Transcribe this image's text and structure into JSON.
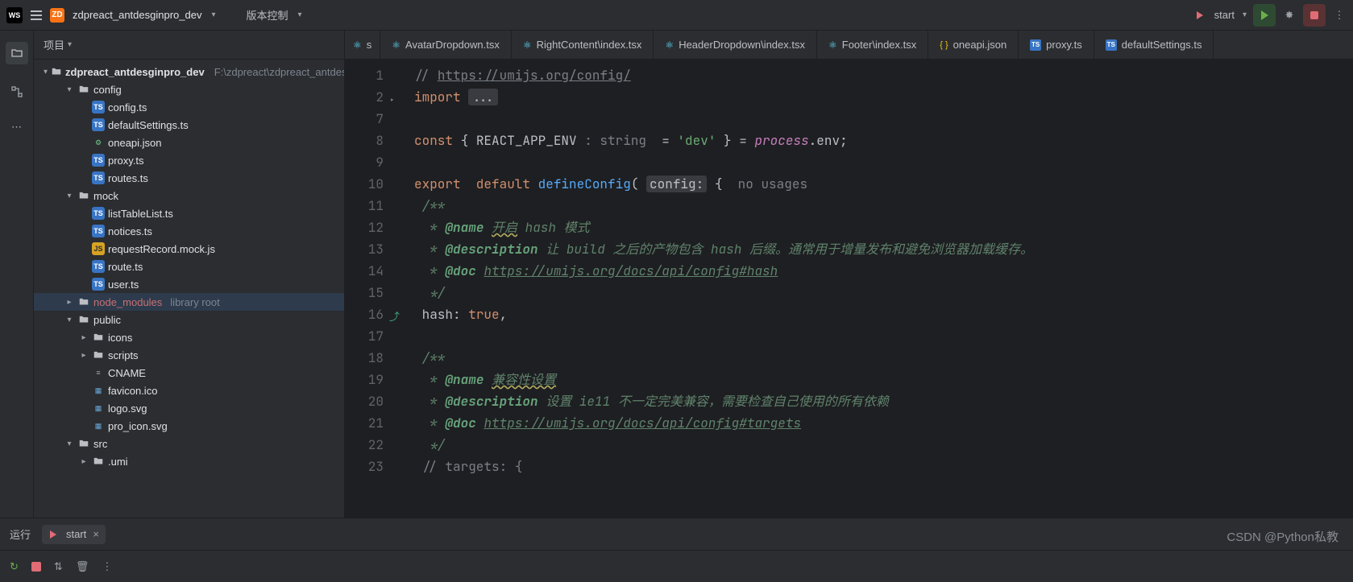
{
  "topbar": {
    "project_name": "zdpreact_antdesginpro_dev",
    "vcs_label": "版本控制",
    "run_config": "start"
  },
  "sidebar": {
    "title": "项目",
    "root": {
      "name": "zdpreact_antdesginpro_dev",
      "path": "F:\\zdpreact\\zdpreact_antdes"
    },
    "nodes": [
      {
        "type": "folder",
        "name": "config",
        "depth": 1,
        "open": true
      },
      {
        "type": "ts",
        "name": "config.ts",
        "depth": 2
      },
      {
        "type": "ts",
        "name": "defaultSettings.ts",
        "depth": 2
      },
      {
        "type": "json",
        "name": "oneapi.json",
        "depth": 2
      },
      {
        "type": "ts",
        "name": "proxy.ts",
        "depth": 2
      },
      {
        "type": "ts",
        "name": "routes.ts",
        "depth": 2
      },
      {
        "type": "folder",
        "name": "mock",
        "depth": 1,
        "open": true
      },
      {
        "type": "ts",
        "name": "listTableList.ts",
        "depth": 2
      },
      {
        "type": "ts",
        "name": "notices.ts",
        "depth": 2
      },
      {
        "type": "js",
        "name": "requestRecord.mock.js",
        "depth": 2
      },
      {
        "type": "ts",
        "name": "route.ts",
        "depth": 2
      },
      {
        "type": "ts",
        "name": "user.ts",
        "depth": 2
      },
      {
        "type": "nodemod",
        "name": "node_modules",
        "depth": 1,
        "open": false,
        "suffix": "library root",
        "sel": true
      },
      {
        "type": "folder",
        "name": "public",
        "depth": 1,
        "open": true
      },
      {
        "type": "folder",
        "name": "icons",
        "depth": 2,
        "open": false
      },
      {
        "type": "folder",
        "name": "scripts",
        "depth": 2,
        "open": false
      },
      {
        "type": "txt",
        "name": "CNAME",
        "depth": 2
      },
      {
        "type": "svg",
        "name": "favicon.ico",
        "depth": 2
      },
      {
        "type": "svg",
        "name": "logo.svg",
        "depth": 2
      },
      {
        "type": "svg",
        "name": "pro_icon.svg",
        "depth": 2
      },
      {
        "type": "folder",
        "name": "src",
        "depth": 1,
        "open": true
      },
      {
        "type": "folder",
        "name": ".umi",
        "depth": 2,
        "open": false
      }
    ]
  },
  "tabs": [
    {
      "icon": "react",
      "label": "s",
      "partial": true
    },
    {
      "icon": "react",
      "label": "AvatarDropdown.tsx"
    },
    {
      "icon": "react",
      "label": "RightContent\\index.tsx"
    },
    {
      "icon": "react",
      "label": "HeaderDropdown\\index.tsx"
    },
    {
      "icon": "react",
      "label": "Footer\\index.tsx"
    },
    {
      "icon": "json",
      "label": "oneapi.json"
    },
    {
      "icon": "ts",
      "label": "proxy.ts"
    },
    {
      "icon": "ts",
      "label": "defaultSettings.ts"
    }
  ],
  "editor": {
    "lines": [
      {
        "n": 1
      },
      {
        "n": 2,
        "fold": true
      },
      {
        "n": 7
      },
      {
        "n": 8
      },
      {
        "n": 9
      },
      {
        "n": 10
      },
      {
        "n": 11
      },
      {
        "n": 12
      },
      {
        "n": 13
      },
      {
        "n": 14
      },
      {
        "n": 15
      },
      {
        "n": 16,
        "inlay": true
      },
      {
        "n": 17
      },
      {
        "n": 18
      },
      {
        "n": 19
      },
      {
        "n": 20
      },
      {
        "n": 21
      },
      {
        "n": 22
      },
      {
        "n": 23
      }
    ],
    "content": {
      "l1_url": "https://umijs.org/config/",
      "l2_import": "import",
      "l2_rest": "...",
      "l8_const": "const",
      "l8_env": "REACT_APP_ENV",
      "l8_hint": ": string",
      "l8_dev": "'dev'",
      "l8_proc": "process",
      "l8_envp": ".env;",
      "l10_exp": "export  default",
      "l10_fn": "defineConfig",
      "l10_param": "config:",
      "l10_nou": "no usages",
      "l11": "/**",
      "l12_tag": "@name",
      "l12_warn": "开启",
      "l12_rest": "hash 模式",
      "l13_tag": "@description",
      "l13_rest": "让 build 之后的产物包含 hash 后缀。通常用于增量发布和避免浏览器加载缓存。",
      "l14_tag": "@doc",
      "l14_url": "https://umijs.org/docs/api/config#hash",
      "l15": " */",
      "l16_key": "hash",
      "l16_val": "true",
      "l18": "/**",
      "l19_tag": "@name",
      "l19_warn": "兼容性设置",
      "l20_tag": "@description",
      "l20_rest": "设置 ie11 不一定完美兼容，需要检查自己使用的所有依赖",
      "l21_tag": "@doc",
      "l21_url": "https://umijs.org/docs/api/config#targets",
      "l22": " */",
      "l23": "// targets: {"
    }
  },
  "run_panel": {
    "label": "运行",
    "tab": "start"
  },
  "watermark": "CSDN @Python私教"
}
